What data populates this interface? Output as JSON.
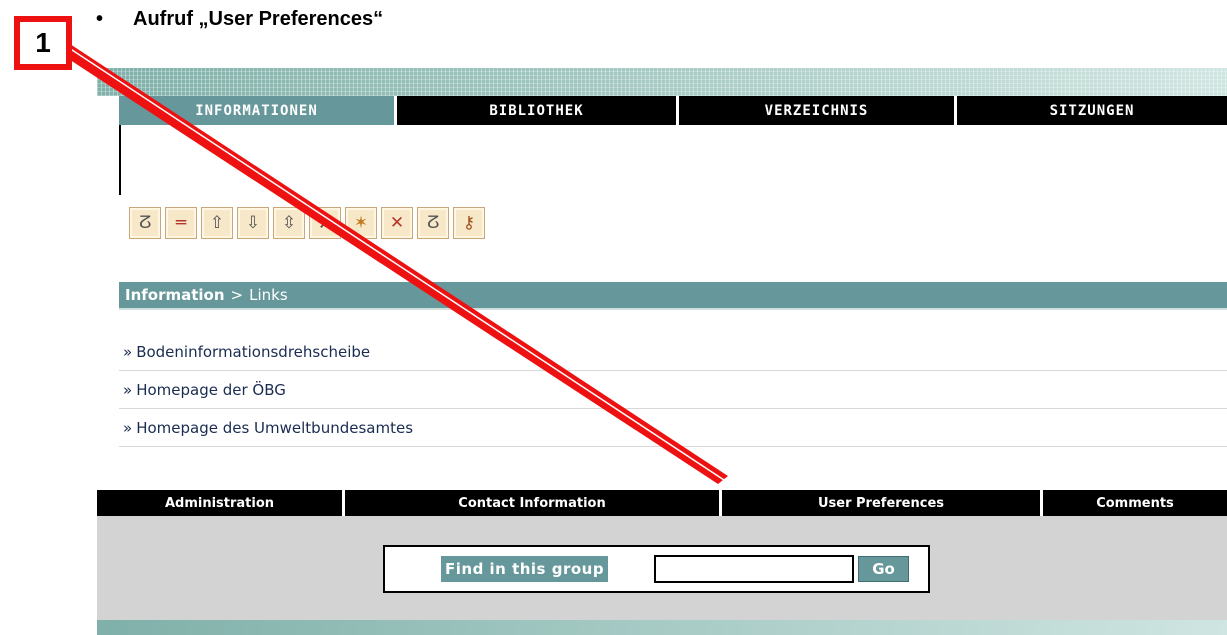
{
  "heading": {
    "bullet": "•",
    "text": "Aufruf „User Preferences“"
  },
  "callout": {
    "number": "1"
  },
  "tabs": [
    {
      "label": "INFORMATIONEN",
      "active": true
    },
    {
      "label": "BIBLIOTHEK",
      "active": false
    },
    {
      "label": "VERZEICHNIS",
      "active": false
    },
    {
      "label": "SITZUNGEN",
      "active": false
    }
  ],
  "toolbar": {
    "icons": [
      "link-icon",
      "remove-icon",
      "upload-icon",
      "download-icon",
      "move-icon",
      "tools-icon",
      "new-link-icon",
      "delete-link-icon",
      "edit-link-icon",
      "key-icon"
    ],
    "glyphs": [
      "ⵒ",
      "═",
      "⇧",
      "⇩",
      "⇳",
      "⚒",
      "✶",
      "✕",
      "ⵒ",
      "⚷"
    ]
  },
  "breadcrumb": {
    "root": "Information",
    "separator": ">",
    "current": "Links"
  },
  "links": [
    {
      "arrow": "»",
      "label": "Bodeninformationsdrehscheibe"
    },
    {
      "arrow": "»",
      "label": "Homepage der ÖBG"
    },
    {
      "arrow": "»",
      "label": "Homepage des Umweltbundesamtes"
    }
  ],
  "footer_nav": [
    "Administration",
    "Contact Information",
    "User Preferences",
    "Comments"
  ],
  "search": {
    "label": "Find in this group",
    "value": "",
    "button": "Go"
  },
  "colors": {
    "teal": "#66979a",
    "annotation_red": "#ee1111",
    "toolbar_bg": "#f6e8c8"
  }
}
